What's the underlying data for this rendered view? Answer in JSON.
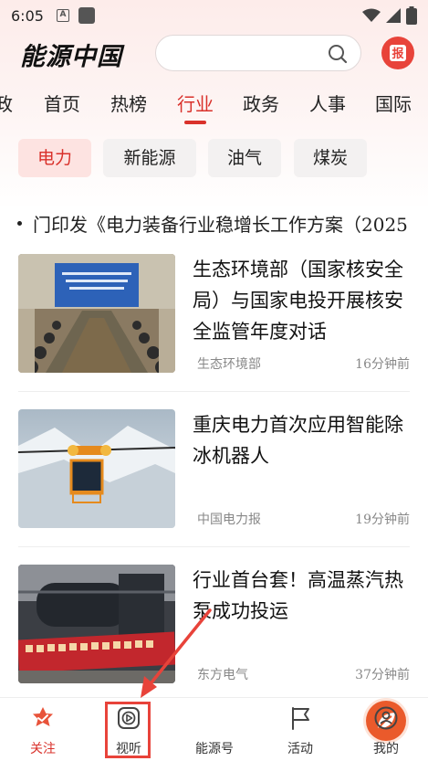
{
  "status_bar": {
    "time": "6:05",
    "a_icon_letter": "A"
  },
  "header": {
    "logo_text": "能源中国",
    "search_placeholder": "",
    "report_icon_text": "报"
  },
  "nav_tabs": [
    {
      "label": "政",
      "active": false
    },
    {
      "label": "首页",
      "active": false
    },
    {
      "label": "热榜",
      "active": false
    },
    {
      "label": "行业",
      "active": true
    },
    {
      "label": "政务",
      "active": false
    },
    {
      "label": "人事",
      "active": false
    },
    {
      "label": "国际",
      "active": false
    }
  ],
  "chips": [
    {
      "label": "电力",
      "active": true
    },
    {
      "label": "新能源",
      "active": false
    },
    {
      "label": "油气",
      "active": false
    },
    {
      "label": "煤炭",
      "active": false
    }
  ],
  "ticker": {
    "text": "门印发《电力装备行业稳增长工作方案（2025"
  },
  "news": [
    {
      "title": "生态环境部（国家核安全局）与国家电投开展核安全监管年度对话",
      "source": "生态环境部",
      "time": "16分钟前",
      "image": "meeting-photo"
    },
    {
      "title": "重庆电力首次应用智能除冰机器人",
      "source": "中国电力报",
      "time": "19分钟前",
      "image": "deicing-robot-photo"
    },
    {
      "title": "行业首台套！高温蒸汽热泵成功投运",
      "source": "东方电气",
      "time": "37分钟前",
      "image": "heat-pump-photo"
    }
  ],
  "tabbar": [
    {
      "label": "关注",
      "icon": "star-badge-icon",
      "active": true
    },
    {
      "label": "视听",
      "icon": "play-icon",
      "active": false
    },
    {
      "label": "能源号",
      "icon": "leaf-icon",
      "active": false
    },
    {
      "label": "活动",
      "icon": "flag-icon",
      "active": false
    },
    {
      "label": "我的",
      "icon": "user-icon",
      "active": false
    }
  ],
  "colors": {
    "accent": "#d9312b",
    "chip_active_bg": "#fde3e1",
    "annotation": "#e8433a"
  }
}
